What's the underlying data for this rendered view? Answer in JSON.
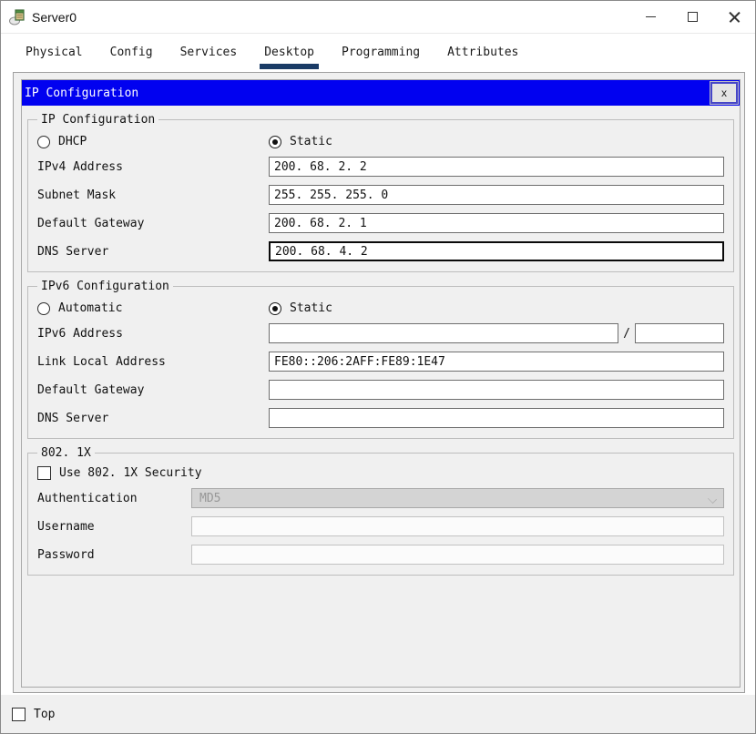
{
  "window": {
    "title": "Server0",
    "controls": {
      "minimize": "minimize-icon",
      "maximize": "maximize-icon",
      "close": "close-icon"
    }
  },
  "tabs": [
    {
      "label": "Physical",
      "active": false
    },
    {
      "label": "Config",
      "active": false
    },
    {
      "label": "Services",
      "active": false
    },
    {
      "label": "Desktop",
      "active": true
    },
    {
      "label": "Programming",
      "active": false
    },
    {
      "label": "Attributes",
      "active": false
    }
  ],
  "dialog": {
    "title": "IP Configuration",
    "close_label": "x"
  },
  "ipv4": {
    "legend": "IP Configuration",
    "radio_dhcp_label": "DHCP",
    "radio_dhcp_checked": false,
    "radio_static_label": "Static",
    "radio_static_checked": true,
    "fields": [
      {
        "label": "IPv4 Address",
        "value": "200. 68. 2. 2"
      },
      {
        "label": "Subnet Mask",
        "value": "255. 255. 255. 0"
      },
      {
        "label": "Default Gateway",
        "value": "200. 68. 2. 1"
      },
      {
        "label": "DNS Server",
        "value": "200. 68. 4. 2",
        "focused": true
      }
    ]
  },
  "ipv6": {
    "legend": "IPv6 Configuration",
    "radio_auto_label": "Automatic",
    "radio_auto_checked": false,
    "radio_static_label": "Static",
    "radio_static_checked": true,
    "address_label": "IPv6 Address",
    "address_value": "",
    "prefix_separator": "/",
    "prefix_value": "",
    "fields": [
      {
        "label": "Link Local Address",
        "value": "FE80::206:2AFF:FE89:1E47"
      },
      {
        "label": "Default Gateway",
        "value": ""
      },
      {
        "label": "DNS Server",
        "value": ""
      }
    ]
  },
  "dot1x": {
    "legend": "802. 1X",
    "checkbox_label": "Use 802. 1X Security",
    "checkbox_checked": false,
    "auth_label": "Authentication",
    "auth_value": "MD5",
    "username_label": "Username",
    "username_value": "",
    "password_label": "Password",
    "password_value": ""
  },
  "footer": {
    "top_label": "Top",
    "top_checked": false
  },
  "colors": {
    "dialog_titlebar": "#0101f0",
    "active_tab_underline": "#1a3b66",
    "panel_background": "#f0f0f0"
  }
}
